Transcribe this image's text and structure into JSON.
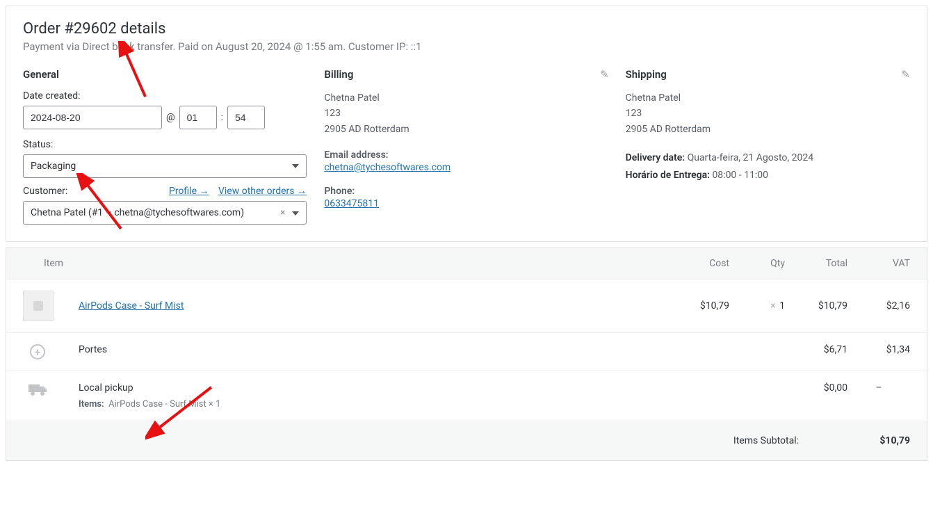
{
  "header": {
    "title": "Order #29602 details",
    "subtitle": "Payment via Direct bank transfer. Paid on August 20, 2024 @ 1:55 am. Customer IP: ::1"
  },
  "general": {
    "heading": "General",
    "date_label": "Date created:",
    "date": "2024-08-20",
    "at": "@",
    "hour": "01",
    "colon": ":",
    "minute": "54",
    "status_label": "Status:",
    "status_value": "Packaging",
    "customer_label": "Customer:",
    "profile_link": "Profile",
    "view_orders_link": "View other orders",
    "customer_value": "Chetna Patel (#1 – chetna@tychesoftwares.com)"
  },
  "billing": {
    "heading": "Billing",
    "name": "Chetna Patel",
    "line1": "123",
    "line2": "2905 AD Rotterdam",
    "email_label": "Email address:",
    "email": "chetna@tychesoftwares.com",
    "phone_label": "Phone:",
    "phone": "0633475811"
  },
  "shipping": {
    "heading": "Shipping",
    "name": "Chetna Patel",
    "line1": "123",
    "line2": "2905 AD Rotterdam",
    "delivery_date_label": "Delivery date:",
    "delivery_date": "Quarta-feira, 21 Agosto, 2024",
    "delivery_time_label": "Horário de Entrega:",
    "delivery_time": "08:00 - 11:00"
  },
  "items_table": {
    "col_item": "Item",
    "col_cost": "Cost",
    "col_qty": "Qty",
    "col_total": "Total",
    "col_vat": "VAT",
    "rows": [
      {
        "name": "AirPods Case - Surf Mist",
        "cost": "$10,79",
        "qty_x": "×",
        "qty": "1",
        "total": "$10,79",
        "vat": "$2,16"
      }
    ],
    "shipping": [
      {
        "icon": "plus",
        "name": "Portes",
        "total": "$6,71",
        "vat": "$1,34"
      },
      {
        "icon": "truck",
        "name": "Local pickup",
        "items_label": "Items:",
        "items": "AirPods Case - Surf Mist × 1",
        "total": "$0,00",
        "vat": "–"
      }
    ]
  },
  "totals": {
    "label": "Items Subtotal:",
    "value": "$10,79"
  }
}
